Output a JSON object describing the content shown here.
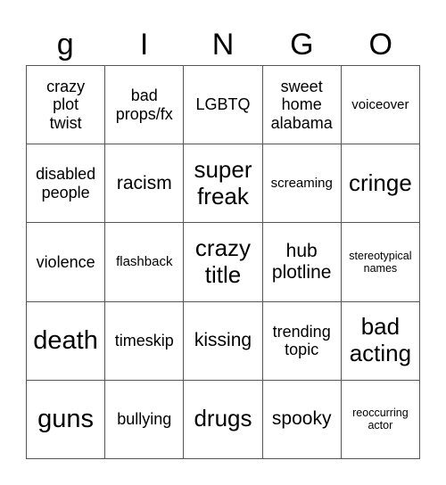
{
  "header": {
    "letters": [
      "g",
      "I",
      "N",
      "G",
      "O"
    ]
  },
  "colors": {
    "grid_line": "#555555",
    "background": "#ffffff",
    "text": "#000000"
  },
  "cells": [
    {
      "text": "crazy\nplot\ntwist",
      "size": "md"
    },
    {
      "text": "bad\nprops/fx",
      "size": "md"
    },
    {
      "text": "LGBTQ",
      "size": "md"
    },
    {
      "text": "sweet\nhome\nalabama",
      "size": "md"
    },
    {
      "text": "voiceover",
      "size": "sm"
    },
    {
      "text": "disabled\npeople",
      "size": "md"
    },
    {
      "text": "racism",
      "size": "lg"
    },
    {
      "text": "super\nfreak",
      "size": "xl"
    },
    {
      "text": "screaming",
      "size": "sm"
    },
    {
      "text": "cringe",
      "size": "xl"
    },
    {
      "text": "violence",
      "size": "md"
    },
    {
      "text": "flashback",
      "size": "sm"
    },
    {
      "text": "crazy\ntitle",
      "size": "xl"
    },
    {
      "text": "hub\nplotline",
      "size": "lg"
    },
    {
      "text": "stereotypical\nnames",
      "size": "xs"
    },
    {
      "text": "death",
      "size": "xxl"
    },
    {
      "text": "timeskip",
      "size": "md"
    },
    {
      "text": "kissing",
      "size": "lg"
    },
    {
      "text": "trending\ntopic",
      "size": "md"
    },
    {
      "text": "bad\nacting",
      "size": "xl"
    },
    {
      "text": "guns",
      "size": "xxl"
    },
    {
      "text": "bullying",
      "size": "md"
    },
    {
      "text": "drugs",
      "size": "xl"
    },
    {
      "text": "spooky",
      "size": "lg"
    },
    {
      "text": "reoccurring\nactor",
      "size": "xs"
    }
  ]
}
